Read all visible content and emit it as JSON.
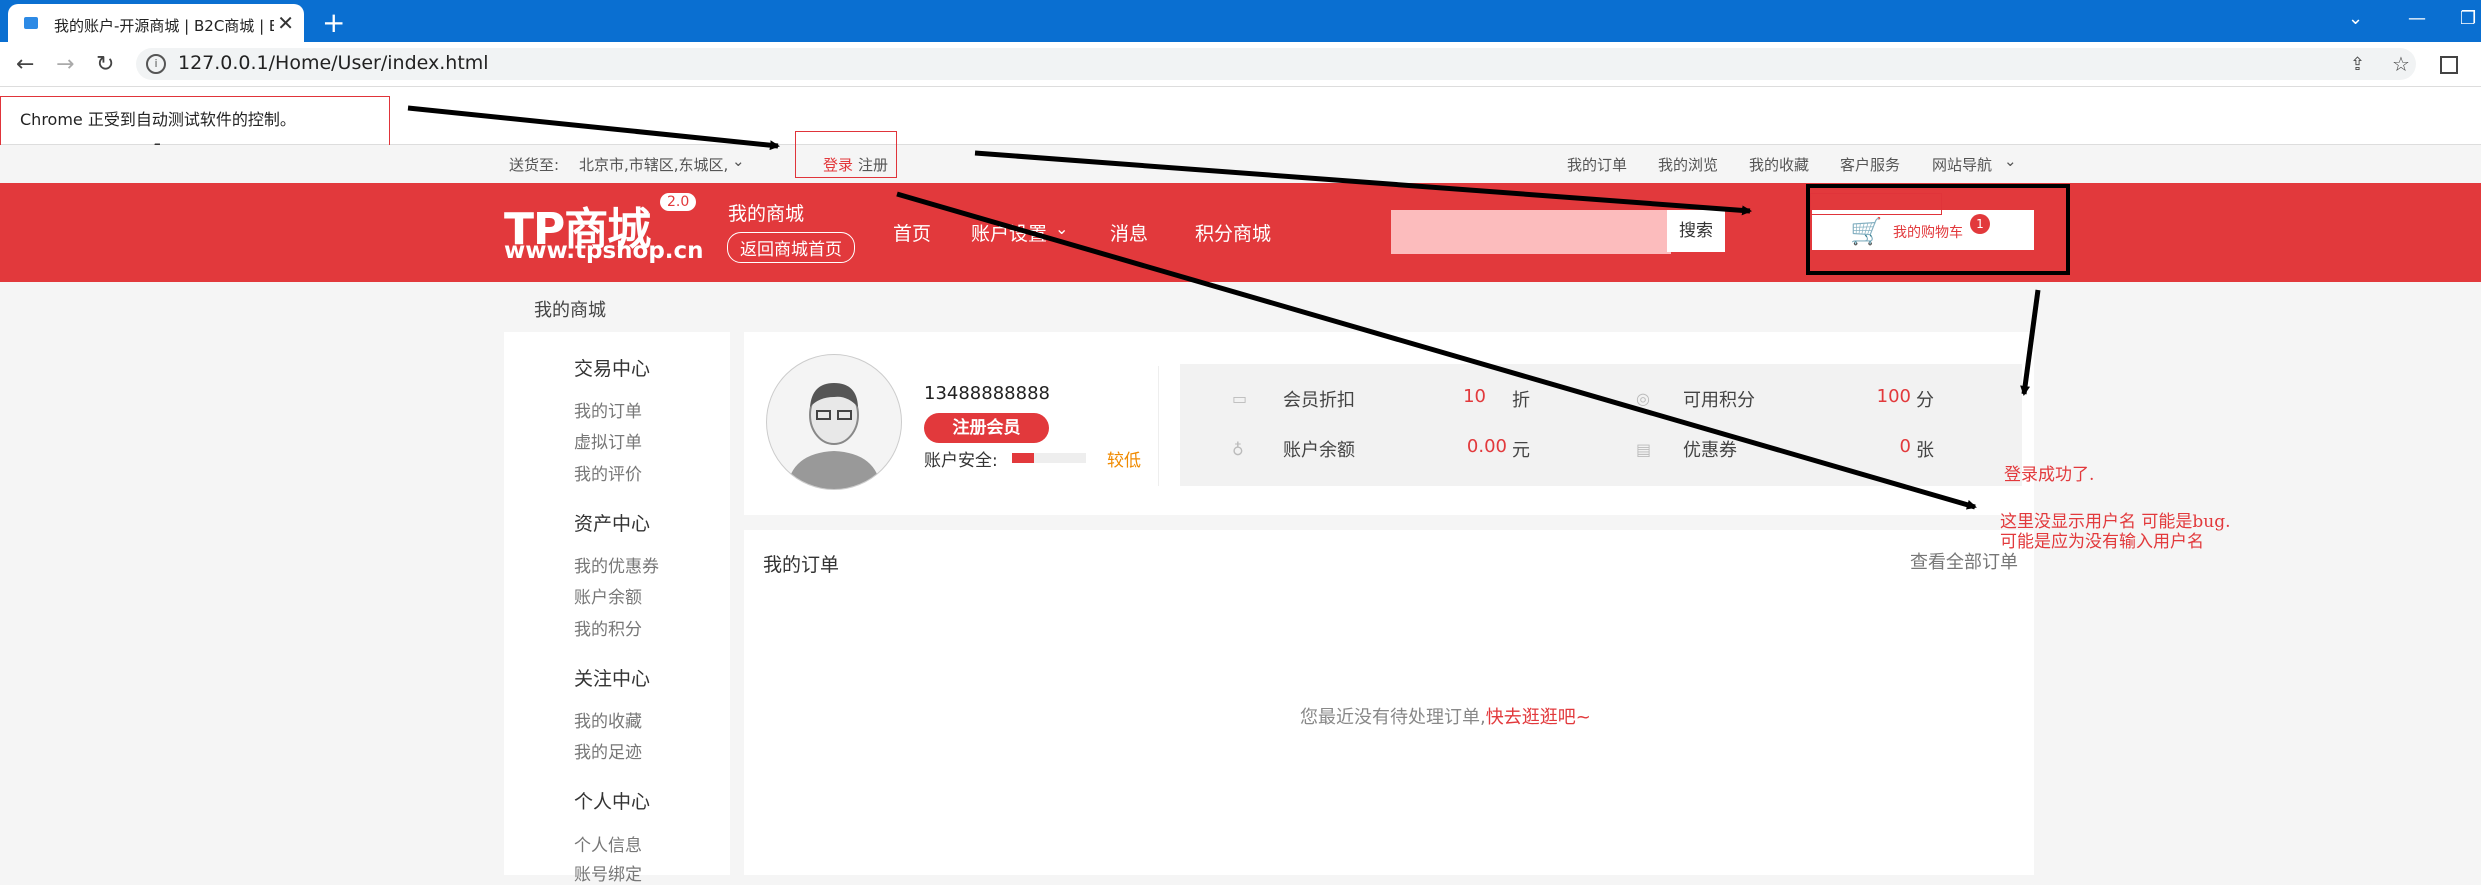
{
  "browser": {
    "tab_title": "我的账户-开源商城 | B2C商城 | B",
    "tab_close": "✕",
    "new_tab": "+",
    "url": "127.0.0.1/Home/User/index.html",
    "minimize": "—",
    "restore": "❐"
  },
  "automation_bar": {
    "text": "Chrome 正受到自动测试软件的控制。"
  },
  "topbar": {
    "ship_to_label": "送货至:",
    "ship_to_value": "北京市,市辖区,东城区,",
    "login": "登录",
    "register": "注册",
    "links": [
      "我的订单",
      "我的浏览",
      "我的收藏",
      "客户服务",
      "网站导航"
    ]
  },
  "header": {
    "logo_text": "TP商城",
    "logo_version": "2.0",
    "logo_url": "www.tpshop.cn",
    "my_mall": "我的商城",
    "back_home": "返回商城首页",
    "nav": [
      "首页",
      "账户设置",
      "消息",
      "积分商城"
    ],
    "search_button": "搜索",
    "cart_label": "我的购物车",
    "cart_count": "1"
  },
  "breadcrumb": "我的商城",
  "sidebar": {
    "sections": [
      {
        "title": "交易中心",
        "items": [
          "我的订单",
          "虚拟订单",
          "我的评价"
        ]
      },
      {
        "title": "资产中心",
        "items": [
          "我的优惠券",
          "账户余额",
          "我的积分"
        ]
      },
      {
        "title": "关注中心",
        "items": [
          "我的收藏",
          "我的足迹"
        ]
      },
      {
        "title": "个人中心",
        "items": [
          "个人信息",
          "账号绑定"
        ]
      }
    ]
  },
  "profile": {
    "phone": "13488888888",
    "member_badge": "注册会员",
    "security_label": "账户安全:",
    "security_level": "较低",
    "security_fill_fraction": 0.3
  },
  "stats": {
    "discount_label": "会员折扣",
    "discount_value": "10",
    "discount_unit": "折",
    "points_label": "可用积分",
    "points_value": "100",
    "points_unit": "分",
    "balance_label": "账户余额",
    "balance_value": "0.00",
    "balance_unit": "元",
    "coupon_label": "优惠券",
    "coupon_value": "0",
    "coupon_unit": "张"
  },
  "orders": {
    "title": "我的订单",
    "view_all": "查看全部订单",
    "empty_text": "您最近没有待处理订单,",
    "empty_link": "快去逛逛吧~"
  },
  "annotations": {
    "note1": "登录成功了.",
    "note2": "这里没显示用户名  可能是bug.",
    "note3": "可能是应为没有输入用户名"
  },
  "colors": {
    "brand_red": "#e2393c",
    "tab_blue": "#0a6fd1",
    "annotation_red": "#e2393c"
  }
}
